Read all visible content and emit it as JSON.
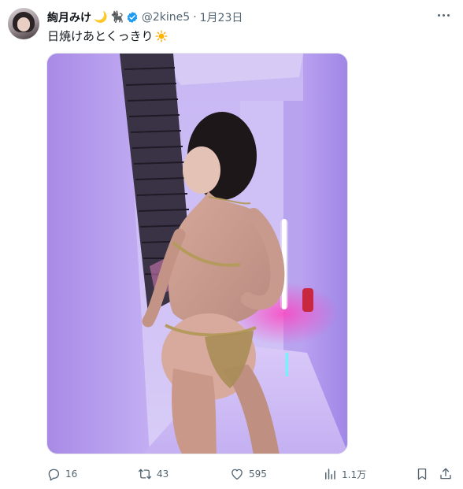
{
  "tweet": {
    "display_name": "絢月みけ",
    "name_emojis": [
      "🌙",
      "🐈‍⬛"
    ],
    "handle": "@2kine5",
    "separator": "·",
    "date": "1月23日",
    "text": "日焼けあとくっきり",
    "text_emoji": "sun-icon",
    "verified_color": "#1d9bf0"
  },
  "stats": {
    "replies": "16",
    "retweets": "43",
    "likes": "595",
    "views": "1.1万"
  },
  "colors": {
    "text_primary": "#0f1419",
    "text_secondary": "#536471",
    "photo_wall": "#b49cf0"
  }
}
